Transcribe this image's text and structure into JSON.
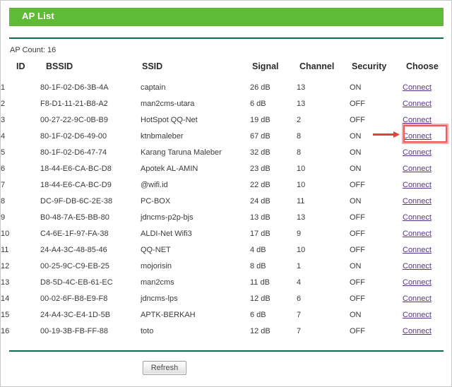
{
  "page": {
    "title": "AP List",
    "ap_count_label": "AP Count: 16",
    "refresh_label": "Refresh",
    "accent_green": "#5fba36",
    "rule_green": "#0d6b4a",
    "link_color": "#59308e",
    "annotation_color": "#f05a5a"
  },
  "table": {
    "headers": {
      "id": "ID",
      "bssid": "BSSID",
      "ssid": "SSID",
      "signal": "Signal",
      "channel": "Channel",
      "security": "Security",
      "choose": "Choose"
    },
    "connect_label": "Connect",
    "rows": [
      {
        "id": "1",
        "bssid": "80-1F-02-D6-3B-4A",
        "ssid": "captain",
        "signal": "26 dB",
        "channel": "13",
        "security": "ON",
        "choose": "Connect"
      },
      {
        "id": "2",
        "bssid": "F8-D1-11-21-B8-A2",
        "ssid": "man2cms-utara",
        "signal": "6 dB",
        "channel": "13",
        "security": "OFF",
        "choose": "Connect"
      },
      {
        "id": "3",
        "bssid": "00-27-22-9C-0B-B9",
        "ssid": "HotSpot QQ-Net",
        "signal": "19 dB",
        "channel": "2",
        "security": "OFF",
        "choose": "Connect"
      },
      {
        "id": "4",
        "bssid": "80-1F-02-D6-49-00",
        "ssid": "ktnbmaleber",
        "signal": "67 dB",
        "channel": "8",
        "security": "ON",
        "choose": "Connect"
      },
      {
        "id": "5",
        "bssid": "80-1F-02-D6-47-74",
        "ssid": "Karang Taruna Maleber",
        "signal": "32 dB",
        "channel": "8",
        "security": "ON",
        "choose": "Connect"
      },
      {
        "id": "6",
        "bssid": "18-44-E6-CA-BC-D8",
        "ssid": "Apotek AL-AMIN",
        "signal": "23 dB",
        "channel": "10",
        "security": "ON",
        "choose": "Connect"
      },
      {
        "id": "7",
        "bssid": "18-44-E6-CA-BC-D9",
        "ssid": "@wifi.id",
        "signal": "22 dB",
        "channel": "10",
        "security": "OFF",
        "choose": "Connect"
      },
      {
        "id": "8",
        "bssid": "DC-9F-DB-6C-2E-38",
        "ssid": "PC-BOX",
        "signal": "24 dB",
        "channel": "11",
        "security": "ON",
        "choose": "Connect"
      },
      {
        "id": "9",
        "bssid": "B0-48-7A-E5-BB-80",
        "ssid": "jdncms-p2p-bjs",
        "signal": "13 dB",
        "channel": "13",
        "security": "OFF",
        "choose": "Connect"
      },
      {
        "id": "10",
        "bssid": "C4-6E-1F-97-FA-38",
        "ssid": "ALDI-Net Wifi3",
        "signal": "17 dB",
        "channel": "9",
        "security": "OFF",
        "choose": "Connect"
      },
      {
        "id": "11",
        "bssid": "24-A4-3C-48-85-46",
        "ssid": "QQ-NET",
        "signal": "4 dB",
        "channel": "10",
        "security": "OFF",
        "choose": "Connect"
      },
      {
        "id": "12",
        "bssid": "00-25-9C-C9-EB-25",
        "ssid": "mojorisin",
        "signal": "8 dB",
        "channel": "1",
        "security": "ON",
        "choose": "Connect"
      },
      {
        "id": "13",
        "bssid": "D8-5D-4C-EB-61-EC",
        "ssid": "man2cms",
        "signal": "11 dB",
        "channel": "4",
        "security": "OFF",
        "choose": "Connect"
      },
      {
        "id": "14",
        "bssid": "00-02-6F-B8-E9-F8",
        "ssid": "jdncms-lps",
        "signal": "12 dB",
        "channel": "6",
        "security": "OFF",
        "choose": "Connect"
      },
      {
        "id": "15",
        "bssid": "24-A4-3C-E4-1D-5B",
        "ssid": "APTK-BERKAH",
        "signal": "6 dB",
        "channel": "7",
        "security": "ON",
        "choose": "Connect"
      },
      {
        "id": "16",
        "bssid": "00-19-3B-FB-FF-88",
        "ssid": "toto",
        "signal": "12 dB",
        "channel": "7",
        "security": "OFF",
        "choose": "Connect"
      }
    ]
  },
  "annotation": {
    "highlighted_row_id": "4",
    "arrow": "right-arrow-annotation",
    "box": "highlight-box-annotation"
  }
}
